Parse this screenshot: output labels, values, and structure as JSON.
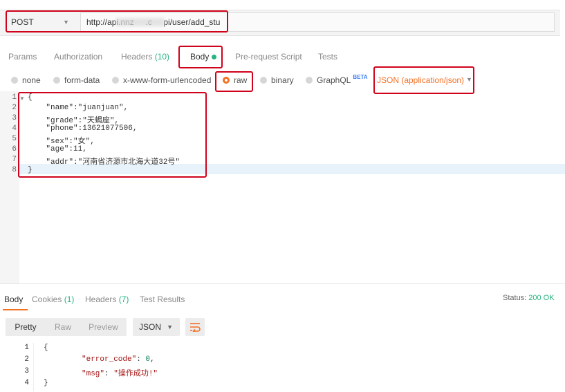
{
  "request": {
    "method": "POST",
    "url": "http://api.nnz     .c     pi/user/add_stu"
  },
  "tabs": [
    {
      "label": "Params",
      "count": ""
    },
    {
      "label": "Authorization",
      "count": ""
    },
    {
      "label": "Headers",
      "count": "(10)"
    },
    {
      "label": "Body",
      "count": ""
    },
    {
      "label": "Pre-request Script",
      "count": ""
    },
    {
      "label": "Tests",
      "count": ""
    }
  ],
  "body_types": {
    "none": "none",
    "form_data": "form-data",
    "urlencoded": "x-www-form-urlencoded",
    "raw": "raw",
    "binary": "binary",
    "graphql": "GraphQL",
    "beta": "BETA",
    "selected": "raw"
  },
  "content_type": "JSON (application/json)",
  "request_body": {
    "line_numbers": [
      "1",
      "2",
      "3",
      "4",
      "5",
      "6",
      "7",
      "8"
    ],
    "lines": [
      "{",
      "    \"name\":\"juanjuan\",",
      "    \"grade\":\"天蝎座\",",
      "    \"phone\":13621077506,",
      "    \"sex\":\"女\",",
      "    \"age\":11,",
      "    \"addr\":\"河南省济源市北海大道32号\"",
      "}"
    ]
  },
  "response_tabs": [
    {
      "label": "Body",
      "count": ""
    },
    {
      "label": "Cookies",
      "count": "(1)"
    },
    {
      "label": "Headers",
      "count": "(7)"
    },
    {
      "label": "Test Results",
      "count": ""
    }
  ],
  "status": {
    "label": "Status:",
    "value": "200 OK"
  },
  "view_modes": [
    "Pretty",
    "Raw",
    "Preview"
  ],
  "selected_view": "Pretty",
  "response_format": "JSON",
  "response_body": {
    "line_numbers": [
      "1",
      "2",
      "3",
      "4"
    ],
    "line1": "{",
    "line2_key": "\"error_code\"",
    "line2_sep": ": ",
    "line2_val": "0",
    "line2_end": ",",
    "line3_key": "\"msg\"",
    "line3_sep": ": ",
    "line3_val": "\"操作成功!\"",
    "line4": "}"
  },
  "colors": {
    "accent": "#f47023",
    "success": "#26b47f",
    "highlight": "#d0021b"
  }
}
